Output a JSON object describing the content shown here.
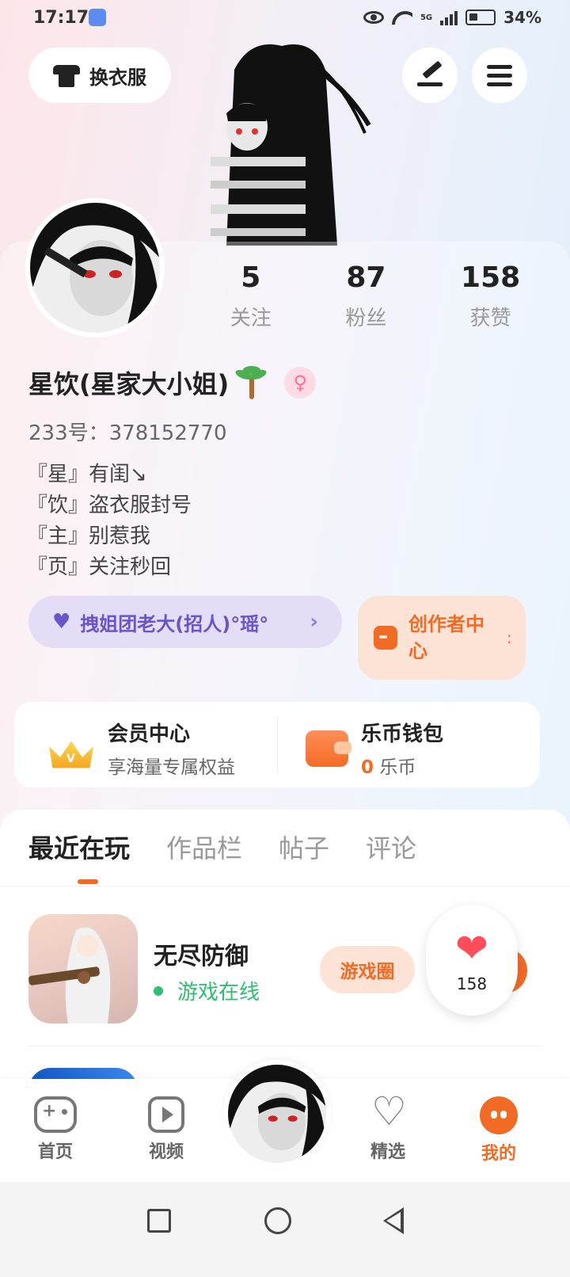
{
  "status_bar": {
    "time": "17:17",
    "network": "5G",
    "battery": "34%"
  },
  "header": {
    "outfit_label": "换衣服"
  },
  "profile": {
    "stats": [
      {
        "value": "5",
        "label": "关注"
      },
      {
        "value": "87",
        "label": "粉丝"
      },
      {
        "value": "158",
        "label": "获赞"
      }
    ],
    "nickname": "星饮(星家大小姐)",
    "gender_symbol": "♀",
    "uid": "233号：378152770",
    "bio": [
      "『星』有闺↘",
      "『饮』盗衣服封号",
      "『主』别惹我",
      "『页』关注秒回"
    ],
    "guild_label": "拽姐团老大(招人)°瑶°",
    "creator_label": "创作者中心"
  },
  "wallet": {
    "vip_title": "会员中心",
    "vip_sub": "享海量专属权益",
    "coin_title": "乐币钱包",
    "coin_value": "0",
    "coin_unit": "乐币"
  },
  "tabs": [
    "最近在玩",
    "作品栏",
    "帖子",
    "评论"
  ],
  "recent_games": [
    {
      "name": "无尽防御",
      "status": "游戏在线",
      "circle_label": "游戏圈"
    }
  ],
  "floating_like": {
    "count": "158"
  },
  "bottom_nav": [
    {
      "label": "首页",
      "icon": "gamepad-icon"
    },
    {
      "label": "视频",
      "icon": "play-icon"
    },
    {
      "label": "精选",
      "icon": "heart-outline-icon"
    },
    {
      "label": "我的",
      "icon": "me-icon",
      "active": true
    }
  ],
  "colors": {
    "accent": "#f26b25",
    "online": "#2fbf71",
    "guild": "#6a55c8",
    "like": "#ff4d5a"
  }
}
